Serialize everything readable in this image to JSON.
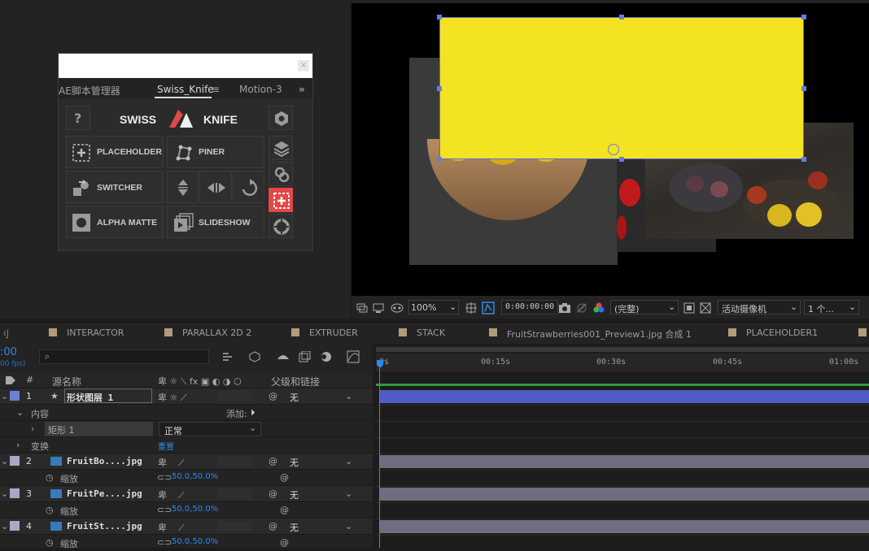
{
  "swiss_knife": {
    "tabs": [
      "AE脚本管理器",
      "Swiss_Knife",
      "Motion-3"
    ],
    "menu_glyph": "≡",
    "more_glyph": "»",
    "close_glyph": "×",
    "help": "?",
    "brand_left": "SWISS",
    "brand_right": "KNIFE",
    "tools": {
      "placeholder": "PLACEHOLDER",
      "piner": "PINER",
      "switcher": "SWITCHER",
      "alpha_matte": "ALPHA MATTE",
      "slideshow": "SLIDESHOW"
    }
  },
  "viewer_toolbar": {
    "zoom": "100%",
    "timecode": "0:00:00:00",
    "resolution": "(完整)",
    "camera": "活动摄像机",
    "views": "1 个..."
  },
  "comp_tabs": [
    "INTERACTOR",
    "PARALLAX 2D 2",
    "EXTRUDER",
    "STACK",
    "FruitStrawberries001_Preview1.jpg 合成 1",
    "PLACEHOLDER1"
  ],
  "timeline": {
    "time": ":00",
    "fps": "00 fps)",
    "search_placeholder": "",
    "header": {
      "num": "#",
      "source_name": "源名称",
      "parent": "父级和链接"
    },
    "ruler": [
      "0s",
      "00:15s",
      "00:30s",
      "00:45s",
      "01:00s"
    ],
    "layers": [
      {
        "num": "1",
        "name": "形状图层 1",
        "parent": "无"
      },
      {
        "num": "2",
        "name": "FruitBo....jpg",
        "parent": "无"
      },
      {
        "num": "3",
        "name": "FruitPe....jpg",
        "parent": "无"
      },
      {
        "num": "4",
        "name": "FruitSt....jpg",
        "parent": "无"
      }
    ],
    "contents_label": "内容",
    "add_label": "添加:",
    "rect_label": "矩形 1",
    "blend_mode": "正常",
    "transform_label": "变换",
    "reset_label": "重置",
    "scale_label": "缩放",
    "scale_value": "50.0,50.0%"
  },
  "colors": {
    "accent": "#2d8ceb",
    "shape": "#f4e323",
    "layer1_bar": "#4f5cc4",
    "footage_bar": "#6e6e80"
  }
}
